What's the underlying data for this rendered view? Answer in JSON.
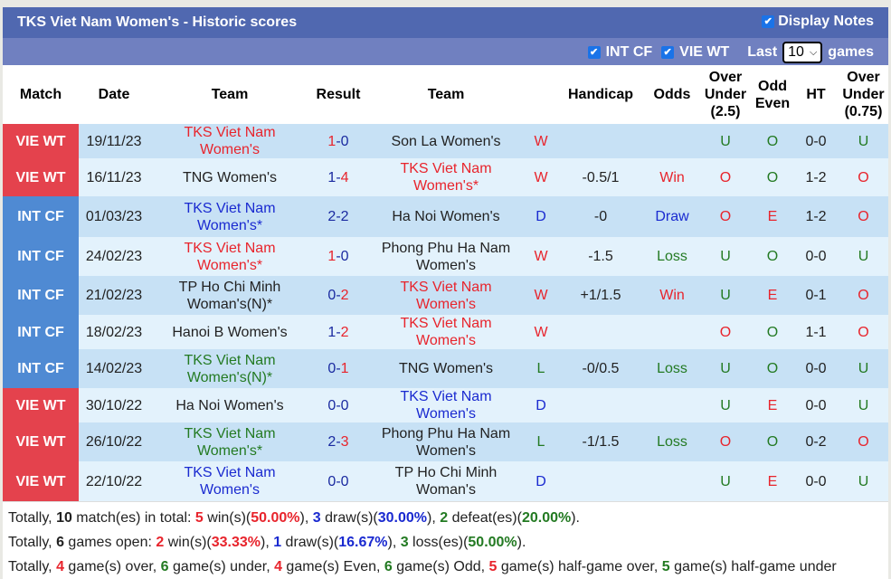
{
  "header": {
    "title": "TKS Viet Nam Women's - Historic scores",
    "display_notes_label": "Display Notes",
    "display_notes_checked": true
  },
  "filters": {
    "int_cf_label": "INT CF",
    "int_cf_checked": true,
    "vie_wt_label": "VIE WT",
    "vie_wt_checked": true,
    "last_label": "Last",
    "last_value": "10",
    "games_label": "games"
  },
  "columns": {
    "match": "Match",
    "date": "Date",
    "team_home": "Team",
    "result": "Result",
    "team_away": "Team",
    "handicap": "Handicap",
    "odds": "Odds",
    "ou_line1": "Over",
    "ou_line2": "Under",
    "ou_line3": "(2.5)",
    "oe_line1": "Odd",
    "oe_line2": "Even",
    "ht": "HT",
    "ou2_line1": "Over",
    "ou2_line2": "Under",
    "ou2_line3": "(0.75)"
  },
  "colors": {
    "vie_wt_badge": "#e4424d",
    "int_cf_badge": "#4f8ad3",
    "header_bar": "#5068b0",
    "filter_bar": "#7080c0",
    "win": "#e8242c",
    "draw": "#1a2ad0",
    "loss": "#237a22"
  },
  "rows": [
    {
      "match": "VIE WT",
      "match_type": "vie",
      "date": "19/11/23",
      "home": "TKS Viet Nam Women's",
      "home_color": "red",
      "score_h": "1",
      "score_a": "0",
      "score_h_color": "red",
      "score_a_color": "navy",
      "away": "Son La Women's",
      "away_color": "dark",
      "wdl": "W",
      "wdl_color": "red",
      "handicap": "",
      "odds": "",
      "odds_color": "dark",
      "ou": "U",
      "ou_color": "green",
      "oe": "O",
      "oe_color": "green",
      "ht": "0-0",
      "ou2": "U",
      "ou2_color": "green"
    },
    {
      "match": "VIE WT",
      "match_type": "vie",
      "date": "16/11/23",
      "home": "TNG Women's",
      "home_color": "dark",
      "score_h": "1",
      "score_a": "4",
      "score_h_color": "navy",
      "score_a_color": "red",
      "away": "TKS Viet Nam Women's*",
      "away_color": "red",
      "wdl": "W",
      "wdl_color": "red",
      "handicap": "-0.5/1",
      "odds": "Win",
      "odds_color": "red",
      "ou": "O",
      "ou_color": "red",
      "oe": "O",
      "oe_color": "green",
      "ht": "1-2",
      "ou2": "O",
      "ou2_color": "red"
    },
    {
      "match": "INT CF",
      "match_type": "int",
      "date": "01/03/23",
      "home": "TKS Viet Nam Women's*",
      "home_color": "blue",
      "score_h": "2",
      "score_a": "2",
      "score_h_color": "navy",
      "score_a_color": "navy",
      "away": "Ha Noi Women's",
      "away_color": "dark",
      "wdl": "D",
      "wdl_color": "blue",
      "handicap": "-0",
      "odds": "Draw",
      "odds_color": "blue",
      "ou": "O",
      "ou_color": "red",
      "oe": "E",
      "oe_color": "red",
      "ht": "1-2",
      "ou2": "O",
      "ou2_color": "red"
    },
    {
      "match": "INT CF",
      "match_type": "int",
      "date": "24/02/23",
      "home": "TKS Viet Nam Women's*",
      "home_color": "red",
      "score_h": "1",
      "score_a": "0",
      "score_h_color": "red",
      "score_a_color": "navy",
      "away": "Phong Phu Ha Nam Women's",
      "away_color": "dark",
      "wdl": "W",
      "wdl_color": "red",
      "handicap": "-1.5",
      "odds": "Loss",
      "odds_color": "green",
      "ou": "U",
      "ou_color": "green",
      "oe": "O",
      "oe_color": "green",
      "ht": "0-0",
      "ou2": "U",
      "ou2_color": "green"
    },
    {
      "match": "INT CF",
      "match_type": "int",
      "date": "21/02/23",
      "home": "TP Ho Chi Minh Woman's(N)*",
      "home_color": "dark",
      "score_h": "0",
      "score_a": "2",
      "score_h_color": "navy",
      "score_a_color": "red",
      "away": "TKS Viet Nam Women's",
      "away_color": "red",
      "wdl": "W",
      "wdl_color": "red",
      "handicap": "+1/1.5",
      "odds": "Win",
      "odds_color": "red",
      "ou": "U",
      "ou_color": "green",
      "oe": "E",
      "oe_color": "red",
      "ht": "0-1",
      "ou2": "O",
      "ou2_color": "red"
    },
    {
      "match": "INT CF",
      "match_type": "int",
      "date": "18/02/23",
      "home": "Hanoi B Women's",
      "home_color": "dark",
      "score_h": "1",
      "score_a": "2",
      "score_h_color": "navy",
      "score_a_color": "red",
      "away": "TKS Viet Nam Women's",
      "away_color": "red",
      "wdl": "W",
      "wdl_color": "red",
      "handicap": "",
      "odds": "",
      "odds_color": "dark",
      "ou": "O",
      "ou_color": "red",
      "oe": "O",
      "oe_color": "green",
      "ht": "1-1",
      "ou2": "O",
      "ou2_color": "red"
    },
    {
      "match": "INT CF",
      "match_type": "int",
      "date": "14/02/23",
      "home": "TKS Viet Nam Women's(N)*",
      "home_color": "green",
      "score_h": "0",
      "score_a": "1",
      "score_h_color": "navy",
      "score_a_color": "red",
      "away": "TNG Women's",
      "away_color": "dark",
      "wdl": "L",
      "wdl_color": "green",
      "handicap": "-0/0.5",
      "odds": "Loss",
      "odds_color": "green",
      "ou": "U",
      "ou_color": "green",
      "oe": "O",
      "oe_color": "green",
      "ht": "0-0",
      "ou2": "U",
      "ou2_color": "green"
    },
    {
      "match": "VIE WT",
      "match_type": "vie",
      "date": "30/10/22",
      "home": "Ha Noi Women's",
      "home_color": "dark",
      "score_h": "0",
      "score_a": "0",
      "score_h_color": "navy",
      "score_a_color": "navy",
      "away": "TKS Viet Nam Women's",
      "away_color": "blue",
      "wdl": "D",
      "wdl_color": "blue",
      "handicap": "",
      "odds": "",
      "odds_color": "dark",
      "ou": "U",
      "ou_color": "green",
      "oe": "E",
      "oe_color": "red",
      "ht": "0-0",
      "ou2": "U",
      "ou2_color": "green"
    },
    {
      "match": "VIE WT",
      "match_type": "vie",
      "date": "26/10/22",
      "home": "TKS Viet Nam Women's*",
      "home_color": "green",
      "score_h": "2",
      "score_a": "3",
      "score_h_color": "navy",
      "score_a_color": "red",
      "away": "Phong Phu Ha Nam Women's",
      "away_color": "dark",
      "wdl": "L",
      "wdl_color": "green",
      "handicap": "-1/1.5",
      "odds": "Loss",
      "odds_color": "green",
      "ou": "O",
      "ou_color": "red",
      "oe": "O",
      "oe_color": "green",
      "ht": "0-2",
      "ou2": "O",
      "ou2_color": "red"
    },
    {
      "match": "VIE WT",
      "match_type": "vie",
      "date": "22/10/22",
      "home": "TKS Viet Nam Women's",
      "home_color": "blue",
      "score_h": "0",
      "score_a": "0",
      "score_h_color": "navy",
      "score_a_color": "navy",
      "away": "TP Ho Chi Minh Woman's",
      "away_color": "dark",
      "wdl": "D",
      "wdl_color": "blue",
      "handicap": "",
      "odds": "",
      "odds_color": "dark",
      "ou": "U",
      "ou_color": "green",
      "oe": "E",
      "oe_color": "red",
      "ht": "0-0",
      "ou2": "U",
      "ou2_color": "green"
    }
  ],
  "summary": {
    "line1": {
      "prefix": "Totally, ",
      "matches": "10",
      "t1": " match(es) in total: ",
      "wins": "5",
      "t2": " win(s)(",
      "win_pct": "50.00%",
      "t3": "), ",
      "draws": "3",
      "t4": " draw(s)(",
      "draw_pct": "30.00%",
      "t5": "), ",
      "defeats": "2",
      "t6": " defeat(es)(",
      "defeat_pct": "20.00%",
      "t7": ")."
    },
    "line2": {
      "prefix": "Totally, ",
      "games_open": "6",
      "t1": " games open: ",
      "wins": "2",
      "t2": " win(s)(",
      "win_pct": "33.33%",
      "t3": "), ",
      "draws": "1",
      "t4": " draw(s)(",
      "draw_pct": "16.67%",
      "t5": "), ",
      "losses": "3",
      "t6": " loss(es)(",
      "loss_pct": "50.00%",
      "t7": ")."
    },
    "line3": {
      "prefix": "Totally, ",
      "over": "4",
      "t1": " game(s) over, ",
      "under": "6",
      "t2": " game(s) under, ",
      "even": "4",
      "t3": " game(s) Even, ",
      "odd": "6",
      "t4": " game(s) Odd, ",
      "hg_over": "5",
      "t5": " game(s) half-game over, ",
      "hg_under": "5",
      "t6": " game(s) half-game under"
    }
  }
}
